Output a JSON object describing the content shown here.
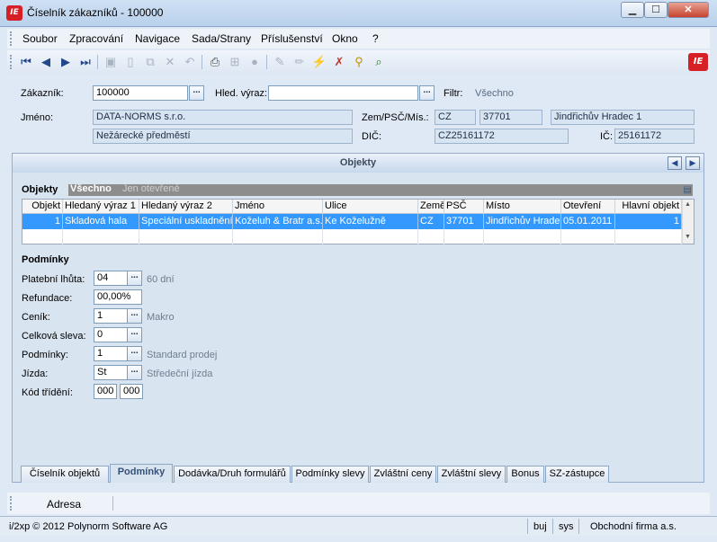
{
  "window": {
    "title": "Číselník zákazníků - 100000",
    "logo_text": "IE",
    "minimize": "▁",
    "maximize": "☐",
    "close": "✕"
  },
  "menu": [
    "Soubor",
    "Zpracování",
    "Navigace",
    "Sada/Strany",
    "Příslušenství",
    "Okno",
    "?"
  ],
  "toolbar_icons": [
    "first-record-icon",
    "prev-record-icon",
    "next-record-icon",
    "last-record-icon",
    "save-icon",
    "new-icon",
    "copy-icon",
    "delete-icon",
    "undo-icon",
    "print-icon",
    "tree-icon",
    "stop-icon",
    "edit-icon",
    "pencil-icon",
    "filter-icon",
    "clear-filter-icon",
    "search-icon",
    "find-icon"
  ],
  "header": {
    "customer_label": "Zákazník:",
    "customer_value": "100000",
    "search_label": "Hled. výraz:",
    "search_value": "",
    "filter_label": "Filtr:",
    "filter_value": "Všechno",
    "name_label": "Jméno:",
    "name_value": "DATA-NORMS s.r.o.",
    "street_value": "Nežárecké předměstí",
    "country_label": "Zem/PSČ/Mís.:",
    "country_value": "CZ",
    "zip_value": "37701",
    "city_value": "Jindřichův Hradec 1",
    "dic_label": "DIČ:",
    "dic_value": "CZ25161172",
    "ic_label": "IČ:",
    "ic_value": "25161172",
    "lookup_button": "..."
  },
  "objects_panel": {
    "title": "Objekty",
    "filter_label": "Objekty",
    "filter_all": "Všechno",
    "filter_open": "Jen otevřené",
    "columns": [
      "Objekt",
      "Hledaný výraz 1",
      "Hledaný výraz 2",
      "Jméno",
      "Ulice",
      "Země",
      "PSČ",
      "Místo",
      "Otevření",
      "Hlavní objekt"
    ],
    "rows": [
      [
        "1",
        "Skladová hala",
        "Speciální uskladnění",
        "Koželuh & Bratr a.s.",
        "Ke Koželužně",
        "CZ",
        "37701",
        "Jindřichův Hradec",
        "05.01.2011",
        "1"
      ]
    ]
  },
  "conditions": {
    "title": "Podmínky",
    "fields": [
      {
        "label": "Platební lhůta:",
        "value": "04",
        "lookup": true,
        "hint": "60 dní"
      },
      {
        "label": "Refundace:",
        "value": "00,00%",
        "lookup": false,
        "hint": ""
      },
      {
        "label": "Ceník:",
        "value": "1",
        "lookup": true,
        "hint": "Makro"
      },
      {
        "label": "Celková sleva:",
        "value": "0",
        "lookup": true,
        "hint": ""
      },
      {
        "label": "Podmínky:",
        "value": "1",
        "lookup": true,
        "hint": "Standard prodej"
      },
      {
        "label": "Jízda:",
        "value": "St",
        "lookup": true,
        "hint": "Středeční jízda"
      }
    ],
    "sort_label": "Kód třídění:",
    "sort_value1": "000",
    "sort_value2": "000"
  },
  "tabs": [
    "Číselník objektů",
    "Podmínky",
    "Dodávka/Druh formulářů",
    "Podmínky slevy",
    "Zvláštní ceny",
    "Zvláštní slevy",
    "Bonus",
    "SZ-zástupce"
  ],
  "active_tab": 1,
  "adresa": "Adresa",
  "status": {
    "copyright": "i/2xp © 2012 Polynorm Software AG",
    "user": "buj",
    "db": "sys",
    "company": "Obchodní firma a.s."
  }
}
